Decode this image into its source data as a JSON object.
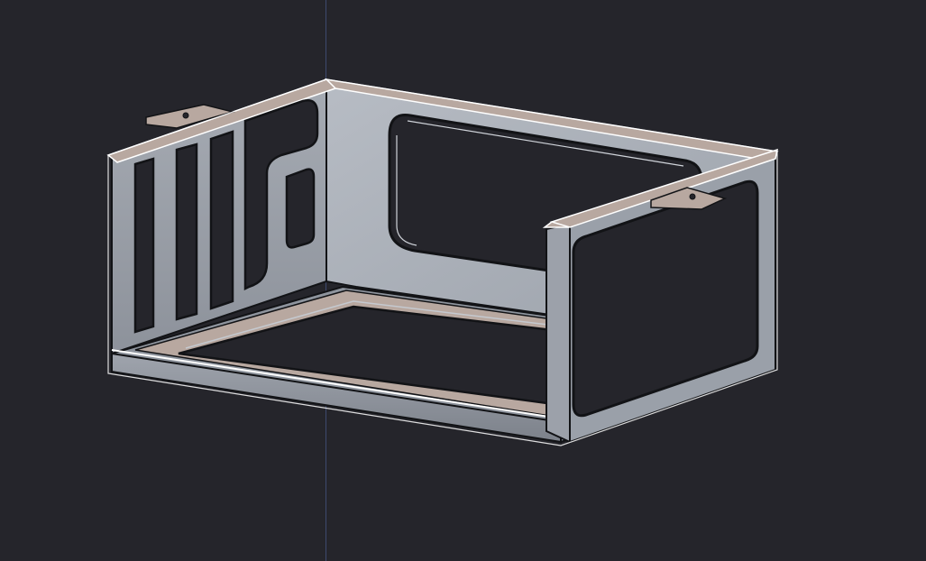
{
  "viewport": {
    "background": "#25252b",
    "axis_color": "#3e4a6e"
  },
  "model": {
    "type": "sheet-metal-enclosure-bracket",
    "body_color": "#aeb3bb",
    "shade_color": "#8e949d",
    "dark_color": "#6e747d",
    "edge_color": "#121316",
    "cut_face_color": "#b8a8a0",
    "silhouette_color": "#ffffff",
    "left_wall_slots": 3,
    "mounting_tabs": 2
  }
}
